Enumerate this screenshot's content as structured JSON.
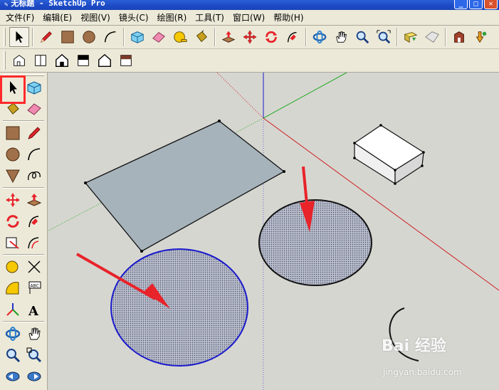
{
  "window": {
    "title": "无标题 - SketchUp Pro",
    "controls": [
      "minimize",
      "maximize",
      "close"
    ]
  },
  "menubar": {
    "items": [
      "文件(F)",
      "编辑(E)",
      "视图(V)",
      "镜头(C)",
      "绘图(R)",
      "工具(T)",
      "窗口(W)",
      "帮助(H)"
    ]
  },
  "toolbar_main": {
    "tools": [
      "select-arrow-icon",
      "pencil-line-icon",
      "rectangle-icon",
      "circle-icon",
      "arc-icon",
      "make-component-icon",
      "eraser-icon",
      "tape-measure-icon",
      "paint-bucket-icon",
      "push-pull-icon",
      "move-icon",
      "rotate-icon",
      "follow-me-icon",
      "orbit-icon",
      "pan-hand-icon",
      "zoom-icon",
      "zoom-extents-icon",
      "add-location-icon",
      "toggle-terrain-icon",
      "warehouse-icon",
      "share-model-icon"
    ]
  },
  "toolbar_views": {
    "tools": [
      "iso-view-icon",
      "top-view-icon",
      "front-view-icon",
      "right-view-icon",
      "back-view-icon",
      "left-view-icon"
    ]
  },
  "toolbar_left": {
    "tools": [
      "select-arrow-icon",
      "make-component-icon",
      "paint-bucket-icon",
      "eraser-icon",
      "rectangle-icon",
      "pencil-line-icon",
      "circle-icon",
      "arc-icon",
      "polygon-icon",
      "freehand-icon",
      "move-icon",
      "push-pull-icon",
      "rotate-icon",
      "follow-me-icon",
      "scale-icon",
      "offset-icon",
      "tape-measure-icon",
      "dimension-icon",
      "protractor-icon",
      "text-label-icon",
      "axes-icon",
      "3d-text-icon",
      "orbit-icon",
      "pan-hand-icon",
      "zoom-icon",
      "zoom-window-icon",
      "previous-view-icon",
      "next-view-icon"
    ],
    "selected": "select-arrow-icon"
  },
  "colors": {
    "viewport_bg": "#d6d6d1",
    "highlight": "#ff2a2a",
    "selected_edge": "#1a1acc",
    "face_fill": "#a7b3bb",
    "circle_fill": "#a8b0c4",
    "arrow": "#e8232a"
  },
  "watermark": {
    "brand": "Bai  经验",
    "url": "jingyan.baidu.com"
  }
}
